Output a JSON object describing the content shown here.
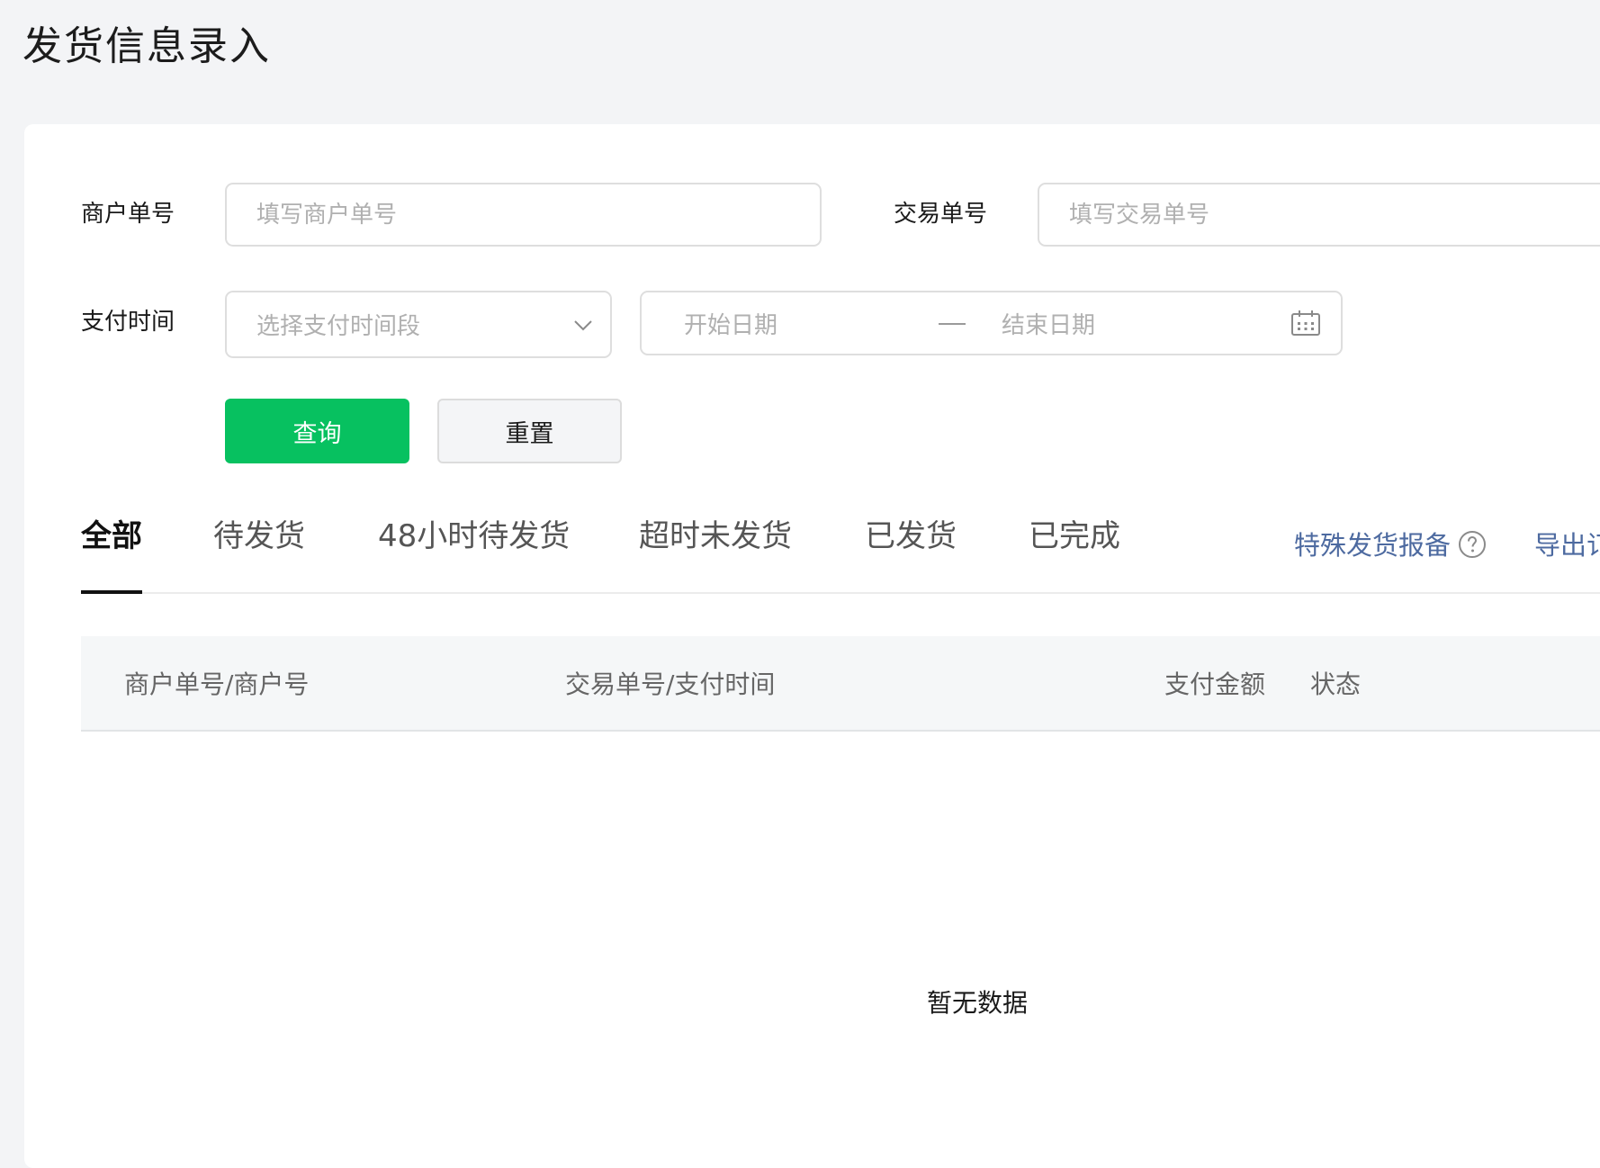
{
  "page": {
    "title": "发货信息录入"
  },
  "filters": {
    "merchant_order": {
      "label": "商户单号",
      "placeholder": "填写商户单号"
    },
    "transaction_order": {
      "label": "交易单号",
      "placeholder": "填写交易单号"
    },
    "pay_time": {
      "label": "支付时间",
      "select_placeholder": "选择支付时间段",
      "start_placeholder": "开始日期",
      "end_placeholder": "结束日期"
    },
    "buttons": {
      "query": "查询",
      "reset": "重置"
    }
  },
  "tabs": [
    {
      "label": "全部",
      "active": true
    },
    {
      "label": "待发货",
      "active": false
    },
    {
      "label": "48小时待发货",
      "active": false
    },
    {
      "label": "超时未发货",
      "active": false
    },
    {
      "label": "已发货",
      "active": false
    },
    {
      "label": "已完成",
      "active": false
    }
  ],
  "links": {
    "special_report": "特殊发货报备",
    "export": "导出订"
  },
  "table": {
    "columns": [
      "商户单号/商户号",
      "交易单号/支付时间",
      "支付金额",
      "状态"
    ],
    "empty_text": "暂无数据"
  },
  "colors": {
    "primary": "#07c160",
    "link": "#4d6aa0",
    "background": "#f3f4f6"
  },
  "icons": {
    "select": "chevron-down-icon",
    "date": "calendar-icon",
    "help": "question-circle-icon"
  }
}
